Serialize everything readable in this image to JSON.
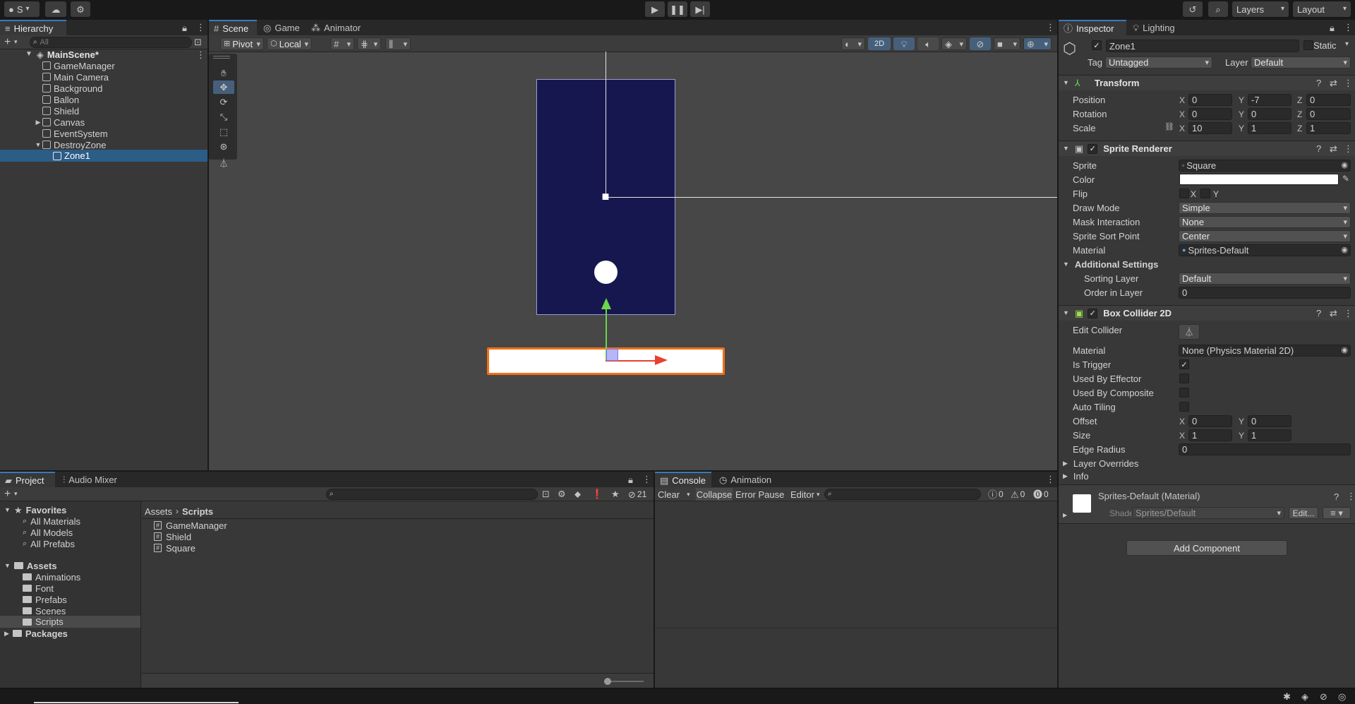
{
  "toolbar": {
    "account_label": "S",
    "layers_label": "Layers",
    "layout_label": "Layout"
  },
  "hierarchy": {
    "tab": "Hierarchy",
    "search_placeholder": "All",
    "scene": "MainScene*",
    "items": [
      "GameManager",
      "Main Camera",
      "Background",
      "Ballon",
      "Shield",
      "Canvas",
      "EventSystem",
      "DestroyZone",
      "Zone1"
    ]
  },
  "scene_view": {
    "tabs": [
      "Scene",
      "Game",
      "Animator"
    ],
    "pivot_label": "Pivot",
    "local_label": "Local",
    "mode_2d_label": "2D"
  },
  "inspector": {
    "tabs": [
      "Inspector",
      "Lighting"
    ],
    "object_name": "Zone1",
    "static_label": "Static",
    "tag_label": "Tag",
    "tag_value": "Untagged",
    "layer_label": "Layer",
    "layer_value": "Default",
    "transform": {
      "title": "Transform",
      "position_label": "Position",
      "rotation_label": "Rotation",
      "scale_label": "Scale",
      "position": {
        "x": "0",
        "y": "-7",
        "z": "0"
      },
      "rotation": {
        "x": "0",
        "y": "0",
        "z": "0"
      },
      "scale": {
        "x": "10",
        "y": "1",
        "z": "1"
      },
      "x": "X",
      "y": "Y",
      "z": "Z"
    },
    "sprite_renderer": {
      "title": "Sprite Renderer",
      "sprite_label": "Sprite",
      "sprite_value": "Square",
      "color_label": "Color",
      "color_value": "#ffffff",
      "flip_label": "Flip",
      "flip_x": "X",
      "flip_y": "Y",
      "draw_mode_label": "Draw Mode",
      "draw_mode_value": "Simple",
      "mask_label": "Mask Interaction",
      "mask_value": "None",
      "sort_point_label": "Sprite Sort Point",
      "sort_point_value": "Center",
      "material_label": "Material",
      "material_value": "Sprites-Default",
      "additional_label": "Additional Settings",
      "sorting_layer_label": "Sorting Layer",
      "sorting_layer_value": "Default",
      "order_label": "Order in Layer",
      "order_value": "0"
    },
    "box_collider": {
      "title": "Box Collider 2D",
      "edit_collider_label": "Edit Collider",
      "material_label": "Material",
      "material_value": "None (Physics Material 2D)",
      "is_trigger_label": "Is Trigger",
      "used_by_effector_label": "Used By Effector",
      "used_by_composite_label": "Used By Composite",
      "auto_tiling_label": "Auto Tiling",
      "offset_label": "Offset",
      "offset": {
        "x": "0",
        "y": "0"
      },
      "size_label": "Size",
      "size": {
        "x": "1",
        "y": "1"
      },
      "edge_radius_label": "Edge Radius",
      "edge_radius_value": "0",
      "layer_overrides_label": "Layer Overrides",
      "info_label": "Info"
    },
    "material_block": {
      "title": "Sprites-Default (Material)",
      "shader_label": "Shader",
      "shader_value": "Sprites/Default",
      "edit_label": "Edit..."
    },
    "add_component_label": "Add Component"
  },
  "project": {
    "tabs": [
      "Project",
      "Audio Mixer"
    ],
    "hidden_count": "21",
    "favorites_label": "Favorites",
    "favorites": [
      "All Materials",
      "All Models",
      "All Prefabs"
    ],
    "assets_label": "Assets",
    "asset_folders": [
      "Animations",
      "Font",
      "Prefabs",
      "Scenes",
      "Scripts"
    ],
    "packages_label": "Packages",
    "breadcrumb_root": "Assets",
    "breadcrumb_current": "Scripts",
    "files": [
      "GameManager",
      "Shield",
      "Square"
    ]
  },
  "console": {
    "tabs": [
      "Console",
      "Animation"
    ],
    "clear_label": "Clear",
    "collapse_label": "Collapse",
    "error_pause_label": "Error Pause",
    "editor_label": "Editor",
    "log_count": "0",
    "warn_count": "0",
    "error_count": "0"
  },
  "colors": {
    "accent": "#3a79bb",
    "selection": "#2c5d87",
    "scene_bg": "#474747",
    "sprite_blue": "#17174f",
    "zone_outline": "#f46f14"
  }
}
